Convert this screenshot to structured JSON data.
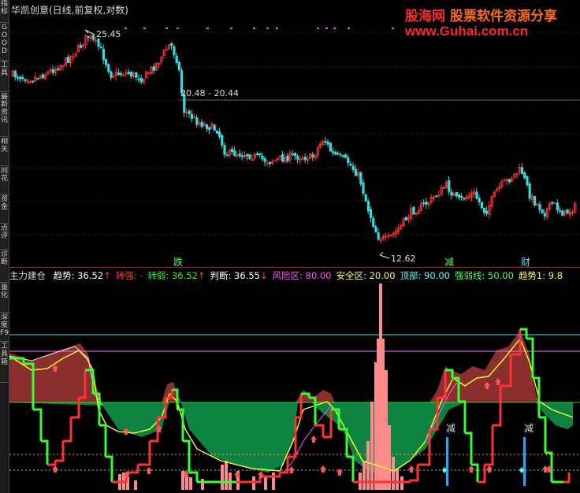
{
  "window": {
    "title": "华凯创意(日线,前复权,对数)"
  },
  "sidebar": {
    "tabs": [
      {
        "label": "指标"
      },
      {
        "label": "GOOD"
      },
      {
        "label": "工具"
      },
      {
        "label": "最新资讯"
      },
      {
        "label": "相关"
      },
      {
        "label": "同花"
      },
      {
        "label": "资金"
      },
      {
        "label": "点评"
      },
      {
        "label": "诊断"
      },
      {
        "label": "量化"
      },
      {
        "label": "深度F9"
      },
      {
        "label": "工具箱"
      }
    ]
  },
  "watermark": {
    "site_name": "股海网",
    "slogan": "股票软件资源分享",
    "url": "www.Guhai.com.cn"
  },
  "price_panel": {
    "high_label": "25.45",
    "range_label": "20.48 - 20.44",
    "low_label": "12.62",
    "markers": [
      "跌",
      "减",
      "财"
    ]
  },
  "indicator": {
    "name": "主力建仓",
    "items": [
      {
        "label": "趋势: 36.52",
        "arrow": "↑",
        "color": "#ffffff"
      },
      {
        "label": "转强: -",
        "arrow": "",
        "color": "#ff3a3a"
      },
      {
        "label": "转弱: 36.52",
        "arrow": "↑",
        "color": "#33ee33"
      },
      {
        "label": "判断: 36.55",
        "arrow": "↓",
        "color": "#ffffff"
      },
      {
        "label": "风险区: 80.00",
        "arrow": "",
        "color": "#ff55ff"
      },
      {
        "label": "安全区: 20.00",
        "arrow": "",
        "color": "#ffff55"
      },
      {
        "label": "顶部: 90.00",
        "arrow": "",
        "color": "#55ffff"
      },
      {
        "label": "强弱线: 50.00",
        "arrow": "",
        "color": "#55ff55"
      },
      {
        "label": "趋势1: 9.8",
        "arrow": "",
        "color": "#ffff55"
      }
    ],
    "markers": [
      "减",
      "减"
    ]
  },
  "colors": {
    "up": "#ff3333",
    "down": "#33dddd",
    "grid": "#7a2020",
    "risk_fill": "#8b2e2e",
    "safe_fill": "#0f8a45",
    "volume": "#ff8a8a"
  }
}
